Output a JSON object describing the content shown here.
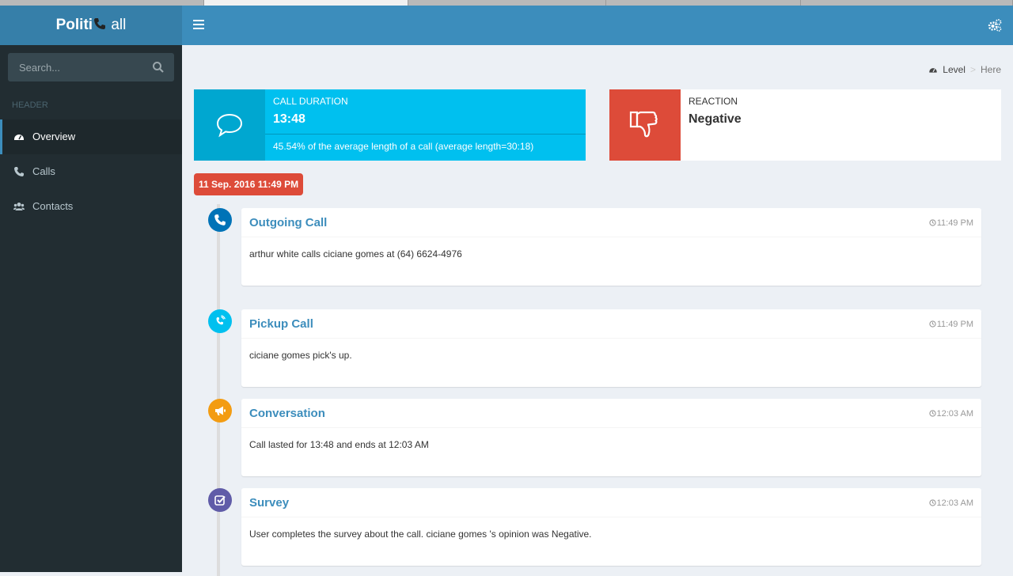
{
  "app": {
    "logo_bold": "Politi",
    "logo_rest": "all"
  },
  "sidebar": {
    "search_placeholder": "Search...",
    "header": "HEADER",
    "items": [
      {
        "label": "Overview",
        "icon": "dashboard-icon",
        "active": true
      },
      {
        "label": "Calls",
        "icon": "phone-icon",
        "active": false
      },
      {
        "label": "Contacts",
        "icon": "users-icon",
        "active": false
      }
    ]
  },
  "breadcrumb": {
    "level": "Level",
    "here": "Here"
  },
  "duration_box": {
    "label": "Call Duration",
    "value": "13:48",
    "description": "45.54% of the average length of a call (average length=30:18)",
    "icon": "comment-icon",
    "color": "#00c0ef"
  },
  "reaction_box": {
    "label": "Reaction",
    "value": "Negative",
    "icon": "thumbs-down-icon",
    "color": "#dd4b39"
  },
  "timeline": {
    "date_label": "11 Sep. 2016 11:49 PM",
    "items": [
      {
        "title": "Outgoing Call",
        "time": "11:49 PM",
        "body": "arthur white calls ciciane gomes at (64) 6624-4976",
        "icon": "phone-icon",
        "color": "#0073b7"
      },
      {
        "title": "Pickup Call",
        "time": "11:49 PM",
        "body": "ciciane gomes pick's up.",
        "icon": "volume-control-phone-icon",
        "color": "#00c0ef"
      },
      {
        "title": "Conversation",
        "time": "12:03 AM",
        "body": "Call lasted for 13:48 and ends at 12:03 AM",
        "icon": "bullhorn-icon",
        "color": "#f39c12"
      },
      {
        "title": "Survey",
        "time": "12:03 AM",
        "body": "User completes the survey about the call. ciciane gomes 's opinion was Negative.",
        "icon": "check-square-icon",
        "color": "#605ca8"
      }
    ]
  }
}
